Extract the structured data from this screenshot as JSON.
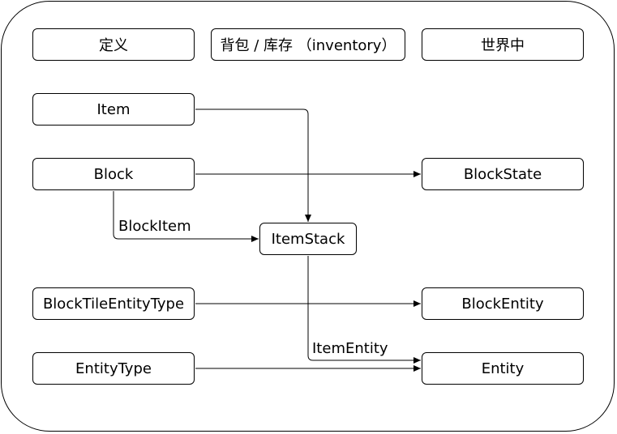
{
  "headers": {
    "definition": "定义",
    "inventory": "背包 / 库存 （inventory）",
    "world": "世界中"
  },
  "nodes": {
    "item": "Item",
    "block": "Block",
    "block_tile_entity_type": "BlockTileEntityType",
    "entity_type": "EntityType",
    "item_stack": "ItemStack",
    "block_state": "BlockState",
    "block_entity": "BlockEntity",
    "entity": "Entity"
  },
  "edge_labels": {
    "block_item": "BlockItem",
    "item_entity": "ItemEntity"
  }
}
